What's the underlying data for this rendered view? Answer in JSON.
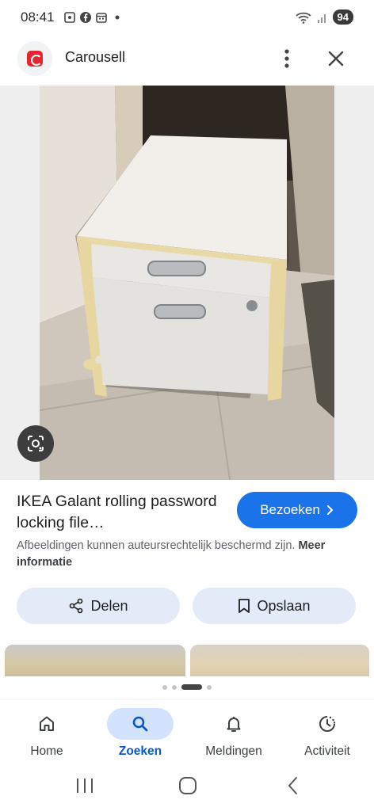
{
  "status": {
    "time": "08:41",
    "battery": "94"
  },
  "appbar": {
    "title": "Carousell"
  },
  "result": {
    "title": "IKEA Galant rolling password locking file…",
    "visit_label": "Bezoeken",
    "notice_text": "Afbeeldingen kunnen auteursrechtelijk beschermd zijn.",
    "notice_link": "Meer informatie"
  },
  "actions": {
    "share_label": "Delen",
    "save_label": "Opslaan"
  },
  "bottom_nav": {
    "items": [
      {
        "label": "Home",
        "icon": "home-icon"
      },
      {
        "label": "Zoeken",
        "icon": "search-icon"
      },
      {
        "label": "Meldingen",
        "icon": "bell-icon"
      },
      {
        "label": "Activiteit",
        "icon": "activity-icon"
      }
    ],
    "active_index": 1
  },
  "colors": {
    "accent": "#1a73e8",
    "pill_bg": "#e3ebf8",
    "active_nav": "#0b57d0",
    "brand_red": "#e3262f"
  }
}
